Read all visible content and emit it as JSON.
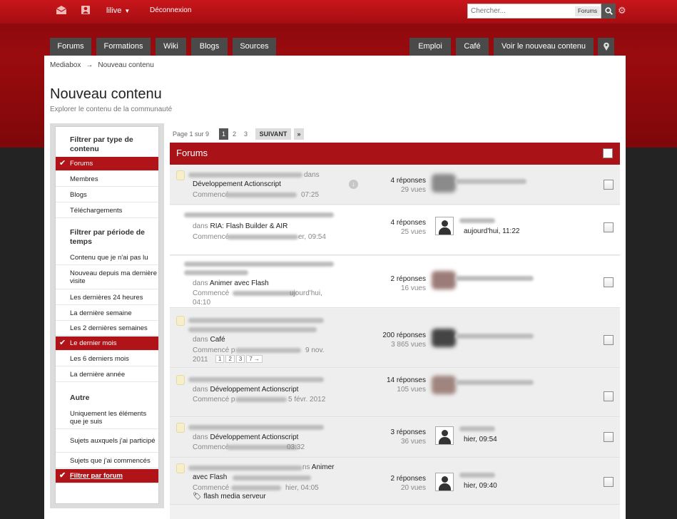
{
  "topbar": {
    "user_label": "lilive",
    "logout_label": "Déconnexion",
    "search_placeholder": "Chercher...",
    "search_scope": "Forums"
  },
  "nav": {
    "left_tabs": [
      "Forums",
      "Formations",
      "Wiki",
      "Blogs",
      "Sources"
    ],
    "right_tabs": [
      "Emploi",
      "Café",
      "Voir le nouveau contenu"
    ]
  },
  "breadcrumb": {
    "home": "Mediabox",
    "arrow": "→",
    "current": "Nouveau contenu"
  },
  "page": {
    "title": "Nouveau contenu",
    "subtitle": "Explorer le contenu de la communauté"
  },
  "sidebar": {
    "type_heading": "Filtrer par type de contenu",
    "type_items": [
      "Forums",
      "Membres",
      "Blogs",
      "Téléchargements"
    ],
    "period_heading": "Filtrer par période de temps",
    "period_items": [
      "Contenu que je n'ai pas lu",
      "Nouveau depuis ma dernière visite",
      "Les dernières 24 heures",
      "La dernière semaine",
      "Les 2 dernières semaines",
      "Le dernier mois",
      "Les 6 derniers mois",
      "La dernière année"
    ],
    "other_heading": "Autre",
    "other_items": [
      "Uniquement les éléments que je suis",
      "Sujets auxquels j'ai participé",
      "Sujets que j'ai commencés",
      "Filtrer par forum"
    ]
  },
  "pagination": {
    "label": "Page 1 sur 9",
    "pages": [
      "1",
      "2",
      "3"
    ],
    "next": "SUIVANT",
    "last": "»"
  },
  "panel": {
    "title": "Forums"
  },
  "rows": [
    {
      "dans": "dans",
      "forum": "Développement Actionscript",
      "started": "Commencé",
      "time": "07:25",
      "replies": "4 réponses",
      "views": "29 vues",
      "last": ""
    },
    {
      "dans": "dans",
      "forum": "RIA: Flash Builder & AIR",
      "started": "Commencé",
      "time": "er, 09:54",
      "replies": "4 réponses",
      "views": "25 vues",
      "last": "aujourd'hui, 11:22"
    },
    {
      "dans": "dans",
      "forum": "Animer avec Flash",
      "started": "Commencé",
      "time": "ujourd'hui,",
      "time2": "04:10",
      "replies": "2 réponses",
      "views": "16 vues",
      "last": ""
    },
    {
      "dans": "dans",
      "forum": "Café",
      "started": "Commencé p",
      "time": "9 nov.",
      "time2": "2011",
      "replies": "200 réponses",
      "views": "3 865 vues",
      "last": "",
      "minipages": [
        "1",
        "2",
        "3",
        "7 →"
      ]
    },
    {
      "dans": "dans",
      "forum": "Développement Actionscript",
      "started": "Commencé p",
      "time": "5 févr. 2012",
      "replies": "14 réponses",
      "views": "105 vues",
      "last": ""
    },
    {
      "dans": "dans",
      "forum": "Développement Actionscript",
      "started": "Commencé",
      "time": "03:32",
      "replies": "3 réponses",
      "views": "36 vues",
      "last": "hier, 09:54"
    },
    {
      "dans": "ns",
      "forum": "Animer",
      "forum2": "avec Flash",
      "started": "Commencé",
      "time": "hier, 04:05",
      "replies": "2 réponses",
      "views": "20 vues",
      "last": "hier, 09:40",
      "tag": "flash media serveur"
    }
  ]
}
